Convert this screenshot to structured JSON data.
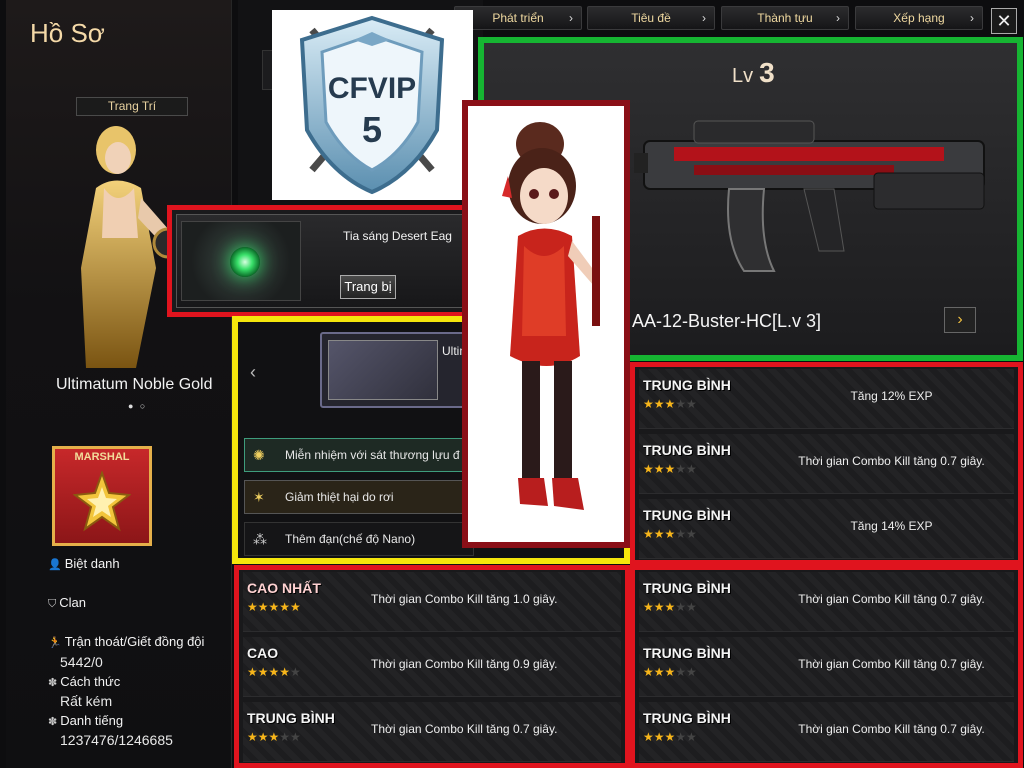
{
  "nav": {
    "tabs": [
      "Phát triển",
      "Tiêu đề",
      "Thành tựu",
      "Xếp hạng"
    ],
    "close": "✕"
  },
  "profile": {
    "title": "Hồ Sơ",
    "decoration_label": "Trang Trí",
    "character_name": "Ultimatum Noble Gold",
    "rank_label": "MARSHAL",
    "nickname_label": "Biệt danh",
    "clan_label": "Clan",
    "escape_kill_label": "Trận thoát/Giết đồng đội",
    "escape_kill_value": "5442/0",
    "behavior_label": "Cách thức",
    "behavior_value": "Rất kém",
    "reputation_label": "Danh tiếng",
    "reputation_value": "1237476/1246685"
  },
  "logo": {
    "text_top": "CFVIP",
    "text_num": "5"
  },
  "weapon_card": {
    "name": "Tia sáng Desert Eag",
    "equip_button": "Trang bị"
  },
  "skill_panel": {
    "set_name": "Ultim",
    "skills": [
      "Miễn nhiệm với sát thương lựu đ",
      "Giảm thiệt hại do rơi",
      "Thêm đạn(chế độ Nano)"
    ]
  },
  "showcase": {
    "level_label": "Lv",
    "level_value": "3",
    "gun_name": "AA-12-Buster-HC[L.v 3]",
    "next_icon": "›"
  },
  "stats_right_top": [
    {
      "tier": "TRUNG BÌNH",
      "stars": 3,
      "desc": "Tăng 12% EXP"
    },
    {
      "tier": "TRUNG BÌNH",
      "stars": 3,
      "desc": "Thời gian Combo Kill tăng 0.7 giây."
    },
    {
      "tier": "TRUNG BÌNH",
      "stars": 3,
      "desc": "Tăng 14% EXP"
    }
  ],
  "stats_left_bottom": [
    {
      "tier": "CAO NHẤT",
      "stars": 5,
      "desc": "Thời gian Combo Kill tăng 1.0 giây."
    },
    {
      "tier": "CAO",
      "stars": 4,
      "desc": "Thời gian Combo Kill tăng 0.9 giây."
    },
    {
      "tier": "TRUNG BÌNH",
      "stars": 3,
      "desc": "Thời gian Combo Kill tăng 0.7 giây."
    }
  ],
  "stats_right_bottom": [
    {
      "tier": "TRUNG BÌNH",
      "stars": 3,
      "desc": "Thời gian Combo Kill tăng 0.7 giây."
    },
    {
      "tier": "TRUNG BÌNH",
      "stars": 3,
      "desc": "Thời gian Combo Kill tăng 0.7 giây."
    },
    {
      "tier": "TRUNG BÌNH",
      "stars": 3,
      "desc": "Thời gian Combo Kill tăng 0.7 giây."
    }
  ],
  "colors": {
    "red_frame": "#e0141e",
    "green_frame": "#16b532",
    "yellow_frame": "#f5e60c",
    "dark_red_frame": "#8a0f17",
    "star": "#f6b51b"
  }
}
